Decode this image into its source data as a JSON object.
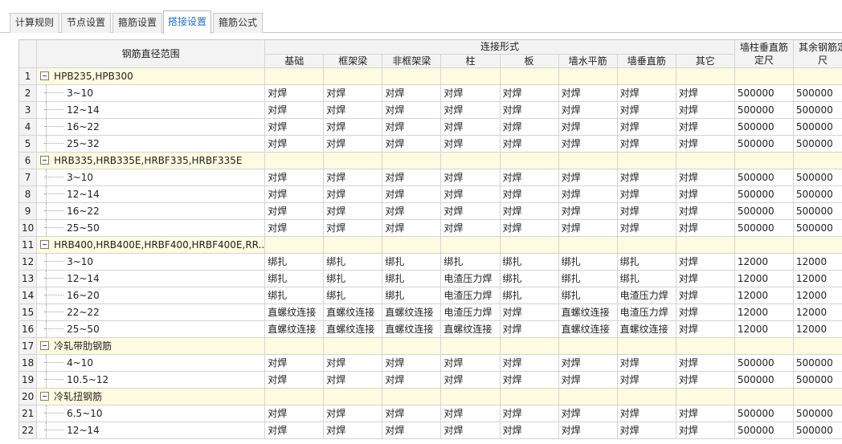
{
  "tabs": [
    {
      "label": "计算规则",
      "active": false
    },
    {
      "label": "节点设置",
      "active": false
    },
    {
      "label": "箍筋设置",
      "active": false
    },
    {
      "label": "搭接设置",
      "active": true
    },
    {
      "label": "箍筋公式",
      "active": false
    }
  ],
  "header": {
    "range": "钢筋直径范围",
    "connection": "连接形式",
    "cols": [
      "基础",
      "框架梁",
      "非框架梁",
      "柱",
      "板",
      "墙水平筋",
      "墙垂直筋",
      "其它"
    ],
    "wall_len": [
      "墙柱垂直筋",
      "定尺"
    ],
    "other_len": [
      "其余钢筋定",
      "尺"
    ]
  },
  "rows": [
    {
      "n": "1",
      "group": true,
      "name": "HPB235,HPB300",
      "cells": []
    },
    {
      "n": "2",
      "name": "3~10",
      "cells": [
        "对焊",
        "对焊",
        "对焊",
        "对焊",
        "对焊",
        "对焊",
        "对焊",
        "对焊",
        "500000",
        "500000"
      ]
    },
    {
      "n": "3",
      "name": "12~14",
      "cells": [
        "对焊",
        "对焊",
        "对焊",
        "对焊",
        "对焊",
        "对焊",
        "对焊",
        "对焊",
        "500000",
        "500000"
      ]
    },
    {
      "n": "4",
      "name": "16~22",
      "cells": [
        "对焊",
        "对焊",
        "对焊",
        "对焊",
        "对焊",
        "对焊",
        "对焊",
        "对焊",
        "500000",
        "500000"
      ]
    },
    {
      "n": "5",
      "name": "25~32",
      "cells": [
        "对焊",
        "对焊",
        "对焊",
        "对焊",
        "对焊",
        "对焊",
        "对焊",
        "对焊",
        "500000",
        "500000"
      ]
    },
    {
      "n": "6",
      "group": true,
      "name": "HRB335,HRB335E,HRBF335,HRBF335E",
      "cells": []
    },
    {
      "n": "7",
      "name": "3~10",
      "cells": [
        "对焊",
        "对焊",
        "对焊",
        "对焊",
        "对焊",
        "对焊",
        "对焊",
        "对焊",
        "500000",
        "500000"
      ]
    },
    {
      "n": "8",
      "name": "12~14",
      "cells": [
        "对焊",
        "对焊",
        "对焊",
        "对焊",
        "对焊",
        "对焊",
        "对焊",
        "对焊",
        "500000",
        "500000"
      ]
    },
    {
      "n": "9",
      "name": "16~22",
      "cells": [
        "对焊",
        "对焊",
        "对焊",
        "对焊",
        "对焊",
        "对焊",
        "对焊",
        "对焊",
        "500000",
        "500000"
      ]
    },
    {
      "n": "10",
      "name": "25~50",
      "cells": [
        "对焊",
        "对焊",
        "对焊",
        "对焊",
        "对焊",
        "对焊",
        "对焊",
        "对焊",
        "500000",
        "500000"
      ]
    },
    {
      "n": "11",
      "group": true,
      "name": "HRB400,HRB400E,HRBF400,HRBF400E,RR...",
      "cells": []
    },
    {
      "n": "12",
      "name": "3~10",
      "cells": [
        "绑扎",
        "绑扎",
        "绑扎",
        "绑扎",
        "绑扎",
        "绑扎",
        "绑扎",
        "对焊",
        "12000",
        "12000"
      ]
    },
    {
      "n": "13",
      "name": "12~14",
      "cells": [
        "绑扎",
        "绑扎",
        "绑扎",
        "电渣压力焊",
        "绑扎",
        "绑扎",
        "绑扎",
        "对焊",
        "12000",
        "12000"
      ]
    },
    {
      "n": "14",
      "name": "16~20",
      "cells": [
        "绑扎",
        "绑扎",
        "绑扎",
        "电渣压力焊",
        "绑扎",
        "绑扎",
        "电渣压力焊",
        "对焊",
        "12000",
        "12000"
      ]
    },
    {
      "n": "15",
      "name": "22~22",
      "cells": [
        "直螺纹连接",
        "直螺纹连接",
        "直螺纹连接",
        "电渣压力焊",
        "对焊",
        "直螺纹连接",
        "电渣压力焊",
        "对焊",
        "12000",
        "12000"
      ]
    },
    {
      "n": "16",
      "name": "25~50",
      "cells": [
        "直螺纹连接",
        "直螺纹连接",
        "直螺纹连接",
        "直螺纹连接",
        "对焊",
        "直螺纹连接",
        "直螺纹连接",
        "对焊",
        "12000",
        "12000"
      ]
    },
    {
      "n": "17",
      "group": true,
      "name": "冷轧带肋钢筋",
      "cells": []
    },
    {
      "n": "18",
      "name": "4~10",
      "cells": [
        "对焊",
        "对焊",
        "对焊",
        "对焊",
        "对焊",
        "对焊",
        "对焊",
        "对焊",
        "500000",
        "500000"
      ]
    },
    {
      "n": "19",
      "name": "10.5~12",
      "cells": [
        "对焊",
        "对焊",
        "对焊",
        "对焊",
        "对焊",
        "对焊",
        "对焊",
        "对焊",
        "500000",
        "500000"
      ]
    },
    {
      "n": "20",
      "group": true,
      "name": "冷轧扭钢筋",
      "cells": []
    },
    {
      "n": "21",
      "name": "6.5~10",
      "cells": [
        "对焊",
        "对焊",
        "对焊",
        "对焊",
        "对焊",
        "对焊",
        "对焊",
        "对焊",
        "500000",
        "500000"
      ]
    },
    {
      "n": "22",
      "name": "12~14",
      "cells": [
        "对焊",
        "对焊",
        "对焊",
        "对焊",
        "对焊",
        "对焊",
        "对焊",
        "对焊",
        "500000",
        "500000"
      ]
    }
  ]
}
